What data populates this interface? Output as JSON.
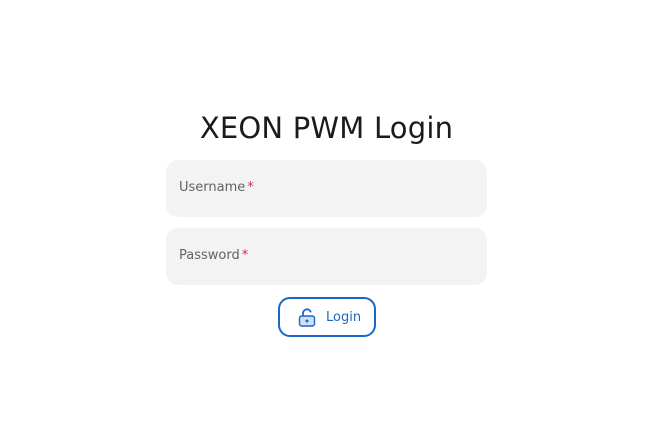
{
  "page": {
    "title": "XEON PWM Login"
  },
  "form": {
    "username": {
      "label": "Username",
      "required_mark": "*",
      "value": ""
    },
    "password": {
      "label": "Password",
      "required_mark": "*",
      "value": ""
    },
    "login_button": {
      "label": "Login",
      "icon": "lock-open-icon"
    }
  },
  "colors": {
    "accent": "#1a66c9",
    "required": "#d32f4e",
    "field_bg": "#f3f3f3",
    "text": "#1b1b1f"
  }
}
